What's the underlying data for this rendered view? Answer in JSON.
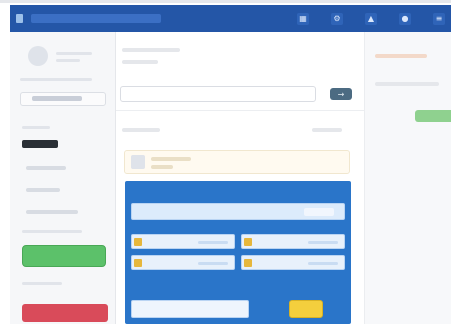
{
  "window": {
    "title": ""
  },
  "topbar": {
    "actions": [
      {
        "icon": "grid-icon",
        "glyph": "▦"
      },
      {
        "icon": "settings-icon",
        "glyph": "⚙"
      },
      {
        "icon": "bell-icon",
        "glyph": "▲"
      },
      {
        "icon": "user-icon",
        "glyph": "●"
      },
      {
        "icon": "menu-icon",
        "glyph": "≡"
      }
    ]
  },
  "sidebar": {
    "primary_label": "",
    "danger_label": ""
  },
  "main": {
    "search_placeholder": "",
    "search_button_glyph": "→"
  },
  "modal": {
    "title": "",
    "field_value": "",
    "input_placeholder": "",
    "confirm_label": ""
  },
  "colors": {
    "header": "#2456a7",
    "modal": "#2a75c9",
    "success": "#5cc16a",
    "danger": "#d94b5a",
    "accent": "#f4cf3d"
  }
}
